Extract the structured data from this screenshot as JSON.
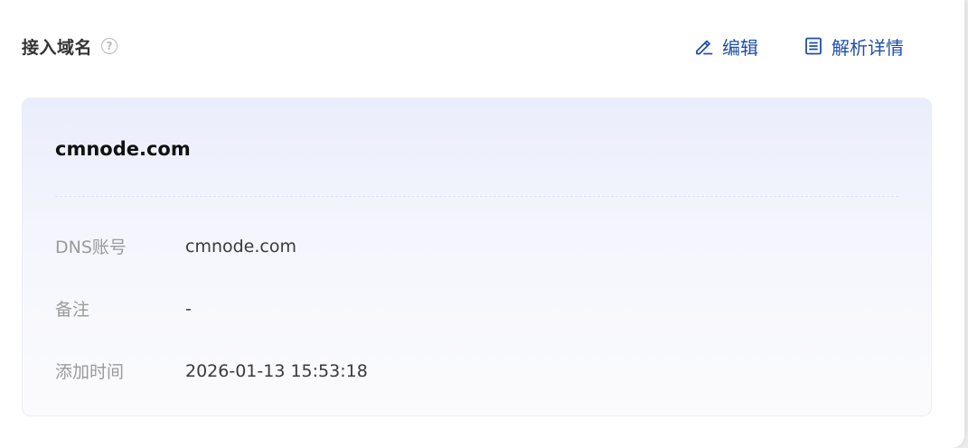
{
  "header": {
    "title": "接入域名",
    "help_icon": "question-circle-icon"
  },
  "actions": {
    "edit": {
      "label": "编辑",
      "icon": "edit-pencil-icon"
    },
    "details": {
      "label": "解析详情",
      "icon": "list-document-icon"
    }
  },
  "colors": {
    "accent": "#1f4fa8",
    "card_gradient_top": "#eaedfb",
    "label_gray": "#9a9a9a"
  },
  "card": {
    "domain": "cmnode.com",
    "fields": [
      {
        "label": "DNS账号",
        "value": "cmnode.com"
      },
      {
        "label": "备注",
        "value": "-"
      },
      {
        "label": "添加时间",
        "value": "2026-01-13 15:53:18"
      }
    ]
  }
}
